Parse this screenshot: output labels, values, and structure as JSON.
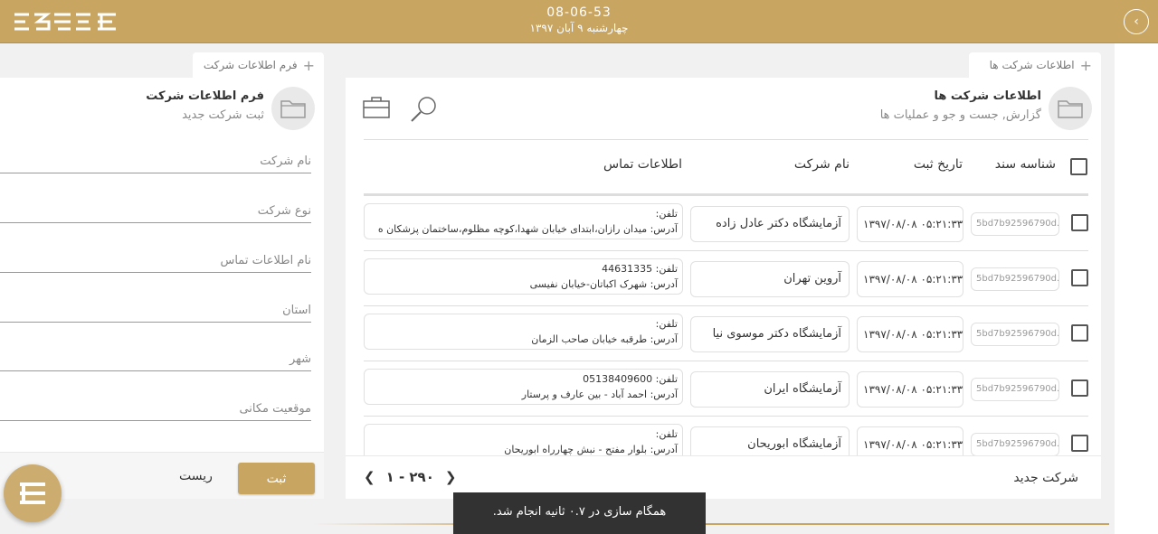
{
  "header": {
    "time": "08-06-53",
    "date": "چهارشنبه ۹ آبان ۱۳۹۷",
    "logo_name": "app-logo",
    "back_icon": "chevron-left-icon",
    "colors": {
      "accent": "#c9a562",
      "dark": "#323232"
    }
  },
  "tabs": {
    "companies": "اطلاعات شرکت ها",
    "form": "فرم اطلاعات شرکت"
  },
  "list_panel": {
    "title": "اطلاعات شرکت ها",
    "subtitle": "گزارش, جست و جو و عملیات ها",
    "columns": {
      "doc_id": "شناسه سند",
      "reg_date": "تاریخ ثبت",
      "company_name": "نام شرکت",
      "contact": "اطلاعات تماس"
    },
    "rows": [
      {
        "id": "5bd7b92596790d...",
        "date": "۱۳۹۷/۰۸/۰۸ ۰۵:۲۱:۳۳",
        "name": "آزمایشگاه دکتر عادل زاده",
        "phone": "تلفن:",
        "address": "آدرس: میدان رازان،ابتدای خیابان شهدا،کوچه مظلوم،ساختمان پزشکان ه"
      },
      {
        "id": "5bd7b92596790d...",
        "date": "۱۳۹۷/۰۸/۰۸ ۰۵:۲۱:۳۳",
        "name": "آروین تهران",
        "phone": "تلفن: 44631335",
        "address": "آدرس: شهرک اکباتان-خیابان نفیسی"
      },
      {
        "id": "5bd7b92596790d...",
        "date": "۱۳۹۷/۰۸/۰۸ ۰۵:۲۱:۳۳",
        "name": "آزمایشگاه دکتر موسوی نیا",
        "phone": "تلفن:",
        "address": "آدرس: طرقبه خیابان صاحب الزمان"
      },
      {
        "id": "5bd7b92596790d...",
        "date": "۱۳۹۷/۰۸/۰۸ ۰۵:۲۱:۳۳",
        "name": "آزمایشگاه ایران",
        "phone": "تلفن: 05138409600",
        "address": "آدرس: احمد آباد - بین عارف و پرستار"
      },
      {
        "id": "5bd7b92596790d...",
        "date": "۱۳۹۷/۰۸/۰۸ ۰۵:۲۱:۳۳",
        "name": "آزمایشگاه ابوریحان",
        "phone": "تلفن:",
        "address": "آدرس: بلوار مفتح - نبش چهارراه ابوریحان"
      }
    ],
    "pager": "۱ - ۲۹۰",
    "new_company": "شرکت جدید"
  },
  "form_panel": {
    "title": "فرم اطلاعات شرکت",
    "subtitle": "ثبت شرکت جدید",
    "fields": [
      "نام شرکت",
      "نوع شرکت",
      "نام اطلاعات تماس",
      "استان",
      "شهر",
      "موقعیت مکانی"
    ],
    "submit": "ثبت",
    "reset": "ریست"
  },
  "toast": "همگام سازی در ۰.۷ ثانیه انجام شد."
}
